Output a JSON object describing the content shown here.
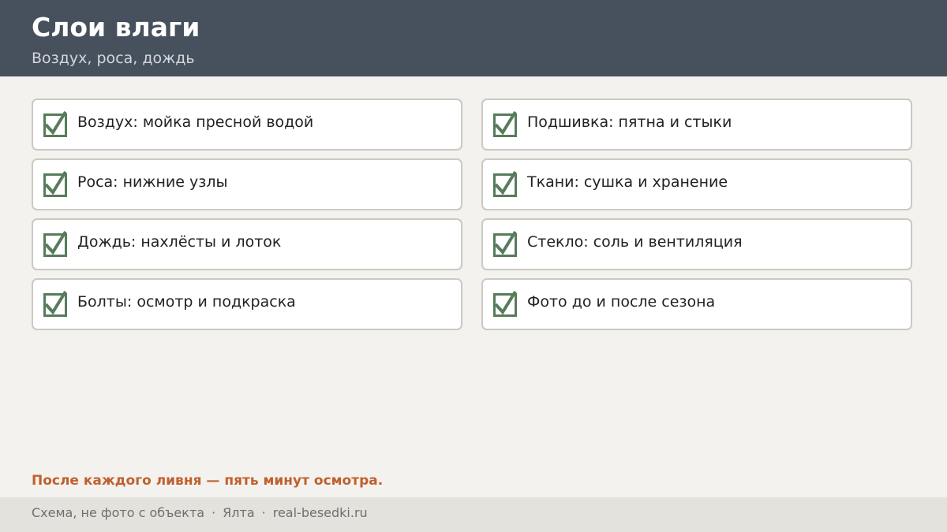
{
  "header": {
    "title": "Слои влаги",
    "subtitle": "Воздух, роса, дождь"
  },
  "checklist": {
    "items": [
      {
        "label": "Воздух: мойка пресной водой",
        "checked": true
      },
      {
        "label": "Подшивка: пятна и стыки",
        "checked": true
      },
      {
        "label": "Роса: нижние узлы",
        "checked": true
      },
      {
        "label": "Ткани: сушка и хранение",
        "checked": true
      },
      {
        "label": "Дождь: нахлёсты и лоток",
        "checked": true
      },
      {
        "label": "Стекло: соль и вентиляция",
        "checked": true
      },
      {
        "label": "Болты: осмотр и подкраска",
        "checked": true
      },
      {
        "label": "Фото до и после сезона",
        "checked": true
      }
    ]
  },
  "note": "После каждого ливня — пять минут осмотра.",
  "footer": {
    "disclaimer": "Схема, не фото с объекта",
    "separator": "·",
    "city": "Ялта",
    "site": "real-besedki.ru"
  },
  "colors": {
    "header_bg": "#47505d",
    "check": "#567c5b",
    "accent": "#c0602e"
  }
}
